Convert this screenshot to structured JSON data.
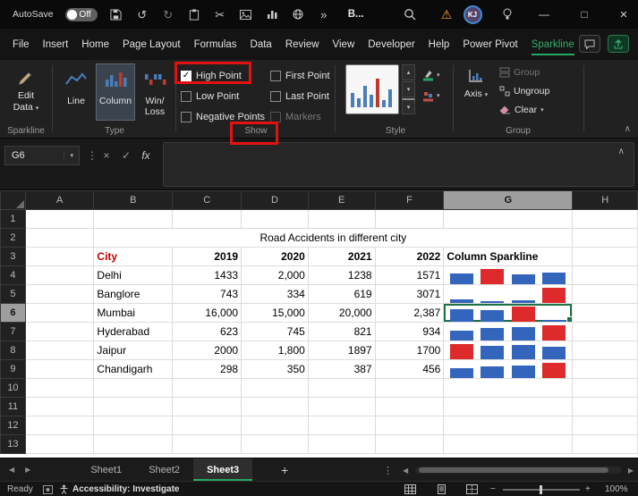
{
  "icons": {
    "dropdown": "▾",
    "undo": "↺",
    "redo": "↻",
    "cut": "✂",
    "overflow": "»",
    "dots": "⋮",
    "cancel": "×",
    "check": "✓",
    "collapse": "∧",
    "minimize": "—",
    "maximize": "□",
    "close": "×",
    "warning": "⚠",
    "left_arrow": "◀",
    "right_arrow": "▶",
    "plus": "+",
    "up_small": "▴",
    "down_small": "▾",
    "zoom_out": "−",
    "zoom_in": "+"
  },
  "title_bar": {
    "autosave_label": "AutoSave",
    "autosave_state": "Off",
    "workbook_title": "B...",
    "user_initials": "KJ"
  },
  "menu": {
    "tabs": [
      "File",
      "Insert",
      "Home",
      "Page Layout",
      "Formulas",
      "Data",
      "Review",
      "View",
      "Developer",
      "Help",
      "Power Pivot",
      "Sparkline"
    ],
    "active_tab": "Sparkline"
  },
  "ribbon": {
    "sparkline_group": {
      "label": "Sparkline",
      "edit_data_label": "Edit Data"
    },
    "type_group": {
      "label": "Type",
      "items": [
        "Line",
        "Column",
        "Win/Loss"
      ],
      "selected": "Column"
    },
    "show_group": {
      "label": "Show",
      "checkboxes": [
        {
          "label": "High Point",
          "checked": true,
          "disabled": false
        },
        {
          "label": "Low Point",
          "checked": false,
          "disabled": false
        },
        {
          "label": "Negative Points",
          "checked": false,
          "disabled": false
        },
        {
          "label": "First Point",
          "checked": false,
          "disabled": false
        },
        {
          "label": "Last Point",
          "checked": false,
          "disabled": false
        },
        {
          "label": "Markers",
          "checked": false,
          "disabled": true
        }
      ]
    },
    "style_group": {
      "label": "Style"
    },
    "group_group": {
      "label": "Group",
      "axis": "Axis",
      "group": "Group",
      "ungroup": "Ungroup",
      "clear": "Clear"
    }
  },
  "formula_bar": {
    "name_box": "G6",
    "fx_label": "fx",
    "formula": ""
  },
  "sheet": {
    "col_headers": [
      "A",
      "B",
      "C",
      "D",
      "E",
      "F",
      "G",
      "H"
    ],
    "row_count": 13,
    "selected_col": "G",
    "selected_row": 6,
    "active_cell": "G6",
    "table": {
      "title": "Road Accidents in different city",
      "headers": [
        "City",
        "2019",
        "2020",
        "2021",
        "2022",
        "Column Sparkline"
      ],
      "rows": [
        {
          "city": "Delhi",
          "display": [
            "1433",
            "2,000",
            "1238",
            "1571"
          ],
          "values": [
            1433,
            2000,
            1238,
            1571
          ]
        },
        {
          "city": "Banglore",
          "display": [
            "743",
            "334",
            "619",
            "3071"
          ],
          "values": [
            743,
            334,
            619,
            3071
          ]
        },
        {
          "city": "Mumbai",
          "display": [
            "16,000",
            "15,000",
            "20,000",
            "2,387"
          ],
          "values": [
            16000,
            15000,
            20000,
            2387
          ]
        },
        {
          "city": "Hyderabad",
          "display": [
            "623",
            "745",
            "821",
            "934"
          ],
          "values": [
            623,
            745,
            821,
            934
          ]
        },
        {
          "city": "Jaipur",
          "display": [
            "2000",
            "1,800",
            "1897",
            "1700"
          ],
          "values": [
            2000,
            1800,
            1897,
            1700
          ]
        },
        {
          "city": "Chandigarh",
          "display": [
            "298",
            "350",
            "387",
            "456"
          ],
          "values": [
            298,
            350,
            387,
            456
          ]
        }
      ],
      "colors": {
        "title_fill": "#ADD8E6",
        "header_fill": "#FFFF00",
        "data_fill": "#E2EFDA",
        "border": "#963634",
        "city_header_text": "#C00000",
        "spark_bar": "#3465BD",
        "spark_high": "#DE2A2A"
      }
    }
  },
  "sheet_tabs": {
    "tabs": [
      "Sheet1",
      "Sheet2",
      "Sheet3"
    ],
    "active": "Sheet3"
  },
  "status_bar": {
    "ready_label": "Ready",
    "accessibility_label": "Accessibility: Investigate",
    "zoom_level": "100%"
  }
}
